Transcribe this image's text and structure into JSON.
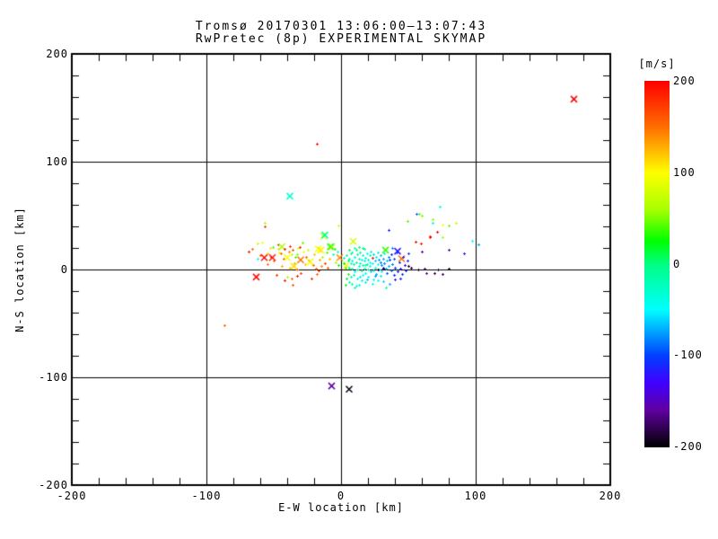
{
  "title": {
    "line1": "Tromsø 20170301 13:06:00–13:07:43",
    "line2": "RwPretec (8p) EXPERIMENTAL SKYMAP"
  },
  "axes": {
    "xlabel": "E-W location [km]",
    "ylabel": "N-S location [km]",
    "x_ticks": [
      "-200",
      "-100",
      "0",
      "100",
      "200"
    ],
    "x_tick_values": [
      -200,
      -100,
      0,
      100,
      200
    ],
    "y_ticks": [
      "200",
      "100",
      "0",
      "-100",
      "-200"
    ],
    "y_tick_values": [
      200,
      100,
      0,
      -100,
      -200
    ],
    "xlim": [
      -200,
      200
    ],
    "ylim": [
      -200,
      200
    ],
    "minor_tick_step_km": 20,
    "gridlines_km": [
      -100,
      0,
      100
    ]
  },
  "colorbar": {
    "unit_label": "[m/s]",
    "ticks": [
      "200",
      "100",
      "0",
      "-100",
      "-200"
    ],
    "tick_values": [
      200,
      100,
      0,
      -100,
      -200
    ],
    "vmin": -200,
    "vmax": 200,
    "anchors": [
      {
        "v": -200,
        "color": "#000000"
      },
      {
        "v": -180,
        "color": "#300050"
      },
      {
        "v": -160,
        "color": "#6000A0"
      },
      {
        "v": -130,
        "color": "#4000FF"
      },
      {
        "v": -100,
        "color": "#0040FF"
      },
      {
        "v": -75,
        "color": "#00A0FF"
      },
      {
        "v": -50,
        "color": "#00FFFF"
      },
      {
        "v": 0,
        "color": "#00FF82"
      },
      {
        "v": 25,
        "color": "#00FF00"
      },
      {
        "v": 60,
        "color": "#AAFF00"
      },
      {
        "v": 100,
        "color": "#FFFF00"
      },
      {
        "v": 150,
        "color": "#FF6E00"
      },
      {
        "v": 200,
        "color": "#FF0000"
      }
    ]
  },
  "chart_data": {
    "type": "scatter",
    "title": "Tromsø 20170301 13:06:00–13:07:43 / RwPretec (8p) EXPERIMENTAL SKYMAP",
    "xlabel": "E-W location [km]",
    "ylabel": "N-S location [km]",
    "xlim": [
      -200,
      200
    ],
    "ylim": [
      -200,
      200
    ],
    "color_variable": "line-of-sight velocity [m/s]",
    "point_format": [
      "x_km",
      "y_km",
      "velocity_ms",
      "marker(d=dot,x=cross)"
    ],
    "points": [
      [
        -69,
        17,
        190,
        "d"
      ],
      [
        -66,
        19,
        150,
        "d"
      ],
      [
        -63,
        -7,
        195,
        "x"
      ],
      [
        -62,
        10,
        -50,
        "d"
      ],
      [
        -62,
        24,
        80,
        "d"
      ],
      [
        -60,
        13,
        155,
        "d"
      ],
      [
        -59,
        25,
        100,
        "d"
      ],
      [
        -57,
        11,
        195,
        "x"
      ],
      [
        -57,
        40,
        170,
        "d"
      ],
      [
        -57,
        43,
        60,
        "d"
      ],
      [
        -55,
        15,
        120,
        "d"
      ],
      [
        -55,
        5,
        145,
        "d"
      ],
      [
        -53,
        20,
        110,
        "d"
      ],
      [
        -52,
        12,
        185,
        "d"
      ],
      [
        -51,
        11,
        190,
        "x"
      ],
      [
        -51,
        21,
        40,
        "d"
      ],
      [
        -50,
        8,
        160,
        "d"
      ],
      [
        -48,
        -5,
        175,
        "d"
      ],
      [
        -47,
        23,
        185,
        "d"
      ],
      [
        -47,
        19,
        65,
        "d"
      ],
      [
        -46,
        16,
        90,
        "d"
      ],
      [
        -45,
        15,
        150,
        "d"
      ],
      [
        -44,
        21,
        60,
        "x"
      ],
      [
        -44,
        3,
        130,
        "d"
      ],
      [
        -43,
        10,
        170,
        "d"
      ],
      [
        -42,
        19,
        185,
        "d"
      ],
      [
        -42,
        -10,
        190,
        "d"
      ],
      [
        -40,
        11,
        100,
        "x"
      ],
      [
        -40,
        -7,
        60,
        "d"
      ],
      [
        -39,
        17,
        140,
        "d"
      ],
      [
        -38,
        22,
        180,
        "d"
      ],
      [
        -38,
        2,
        120,
        "d"
      ],
      [
        -37,
        14,
        70,
        "d"
      ],
      [
        -37,
        -8,
        150,
        "d"
      ],
      [
        -36,
        18,
        160,
        "d"
      ],
      [
        -36,
        -14,
        160,
        "d"
      ],
      [
        -35,
        6,
        130,
        "d"
      ],
      [
        -35,
        3,
        110,
        "x"
      ],
      [
        -34,
        12,
        40,
        "d"
      ],
      [
        -33,
        14,
        50,
        "d"
      ],
      [
        -33,
        0,
        150,
        "d"
      ],
      [
        -33,
        -6,
        190,
        "d"
      ],
      [
        -32,
        20,
        90,
        "d"
      ],
      [
        -31,
        21,
        180,
        "d"
      ],
      [
        -30,
        9,
        150,
        "x"
      ],
      [
        -30,
        -3,
        170,
        "d"
      ],
      [
        -29,
        25,
        45,
        "d"
      ],
      [
        -28,
        17,
        100,
        "d"
      ],
      [
        -27,
        5,
        120,
        "d"
      ],
      [
        -26,
        12,
        150,
        "d"
      ],
      [
        -25,
        18,
        75,
        "d"
      ],
      [
        -24,
        8,
        185,
        "d"
      ],
      [
        -23,
        7,
        100,
        "x"
      ],
      [
        -22,
        -8,
        180,
        "d"
      ],
      [
        -21,
        4,
        150,
        "d"
      ],
      [
        -20,
        14,
        120,
        "d"
      ],
      [
        -19,
        1,
        165,
        "d"
      ],
      [
        -18,
        -4,
        150,
        "d"
      ],
      [
        -17,
        -1,
        190,
        "d"
      ],
      [
        -17,
        19,
        95,
        "x"
      ],
      [
        -16,
        9,
        130,
        "d"
      ],
      [
        -15,
        3,
        140,
        "d"
      ],
      [
        -15,
        18,
        105,
        "x"
      ],
      [
        -14,
        12,
        60,
        "d"
      ],
      [
        -13,
        31,
        80,
        "x"
      ],
      [
        -12,
        32,
        -10,
        "x"
      ],
      [
        -12,
        6,
        170,
        "d"
      ],
      [
        -11,
        16,
        45,
        "d"
      ],
      [
        -10,
        2,
        155,
        "d"
      ],
      [
        -9,
        10,
        120,
        "d"
      ],
      [
        -8,
        21,
        30,
        "x"
      ],
      [
        -7,
        21,
        50,
        "x"
      ],
      [
        -6,
        14,
        -20,
        "d"
      ],
      [
        -5,
        19,
        35,
        "d"
      ],
      [
        -4,
        7,
        60,
        "d"
      ],
      [
        -3,
        17,
        -45,
        "d"
      ],
      [
        -2,
        4,
        25,
        "d"
      ],
      [
        -2,
        41,
        80,
        "d"
      ],
      [
        -1,
        11,
        140,
        "x"
      ],
      [
        3,
        -14,
        20,
        "d"
      ],
      [
        4,
        4,
        90,
        "x"
      ],
      [
        2,
        11,
        -15,
        "d"
      ],
      [
        5,
        -4,
        30,
        "d"
      ],
      [
        6,
        2,
        -10,
        "d"
      ],
      [
        6,
        10,
        -25,
        "d"
      ],
      [
        7,
        -7,
        -30,
        "d"
      ],
      [
        7,
        15,
        -5,
        "d"
      ],
      [
        8,
        1,
        -20,
        "d"
      ],
      [
        8,
        8,
        -35,
        "d"
      ],
      [
        8,
        -13,
        -25,
        "d"
      ],
      [
        9,
        26,
        80,
        "x"
      ],
      [
        9,
        5,
        -15,
        "d"
      ],
      [
        10,
        12,
        -30,
        "d"
      ],
      [
        10,
        -2,
        -40,
        "d"
      ],
      [
        10,
        -17,
        -30,
        "d"
      ],
      [
        11,
        7,
        -10,
        "d"
      ],
      [
        11,
        18,
        5,
        "d"
      ],
      [
        12,
        0,
        -25,
        "d"
      ],
      [
        12,
        -8,
        -45,
        "d"
      ],
      [
        13,
        10,
        -20,
        "d"
      ],
      [
        13,
        3,
        -35,
        "d"
      ],
      [
        13,
        -14,
        -40,
        "d"
      ],
      [
        14,
        16,
        -10,
        "d"
      ],
      [
        14,
        6,
        -30,
        "d"
      ],
      [
        15,
        -1,
        -15,
        "d"
      ],
      [
        15,
        9,
        -45,
        "d"
      ],
      [
        15,
        -10,
        -35,
        "d"
      ],
      [
        16,
        13,
        -25,
        "d"
      ],
      [
        16,
        4,
        -5,
        "d"
      ],
      [
        16,
        -5,
        -50,
        "d"
      ],
      [
        17,
        19,
        0,
        "d"
      ],
      [
        17,
        8,
        -35,
        "d"
      ],
      [
        17,
        1,
        -20,
        "d"
      ],
      [
        18,
        -3,
        -45,
        "d"
      ],
      [
        18,
        11,
        -30,
        "d"
      ],
      [
        18,
        -12,
        -55,
        "d"
      ],
      [
        19,
        5,
        -15,
        "d"
      ],
      [
        19,
        15,
        -40,
        "d"
      ],
      [
        20,
        0,
        -30,
        "d"
      ],
      [
        20,
        9,
        -55,
        "d"
      ],
      [
        20,
        -7,
        -45,
        "d"
      ],
      [
        21,
        13,
        -20,
        "d"
      ],
      [
        21,
        3,
        -40,
        "d"
      ],
      [
        22,
        -2,
        -60,
        "d"
      ],
      [
        22,
        17,
        -35,
        "d"
      ],
      [
        23,
        11,
        190,
        "d"
      ],
      [
        23,
        6,
        -50,
        "d"
      ],
      [
        24,
        -1,
        -40,
        "d"
      ],
      [
        24,
        14,
        -60,
        "d"
      ],
      [
        24,
        -9,
        -50,
        "d"
      ],
      [
        25,
        8,
        -65,
        "d"
      ],
      [
        25,
        2,
        -30,
        "d"
      ],
      [
        26,
        12,
        -55,
        "d"
      ],
      [
        26,
        -4,
        -70,
        "d"
      ],
      [
        27,
        5,
        -45,
        "d"
      ],
      [
        27,
        16,
        -25,
        "d"
      ],
      [
        28,
        0,
        -60,
        "d"
      ],
      [
        28,
        9,
        -75,
        "d"
      ],
      [
        29,
        -6,
        -55,
        "d"
      ],
      [
        29,
        13,
        -65,
        "d"
      ],
      [
        30,
        4,
        -80,
        "d"
      ],
      [
        30,
        -2,
        -50,
        "d"
      ],
      [
        31,
        10,
        -70,
        "d"
      ],
      [
        31,
        -11,
        -60,
        "d"
      ],
      [
        32,
        6,
        -85,
        "d"
      ],
      [
        32,
        15,
        -45,
        "d"
      ],
      [
        33,
        1,
        -75,
        "d"
      ],
      [
        33,
        18,
        35,
        "x"
      ],
      [
        34,
        -3,
        -90,
        "d"
      ],
      [
        34,
        8,
        -65,
        "d"
      ],
      [
        35,
        12,
        -80,
        "d"
      ],
      [
        35,
        3,
        -70,
        "d"
      ],
      [
        5,
        8,
        -5,
        "d"
      ],
      [
        4,
        -8,
        15,
        "d"
      ],
      [
        3,
        2,
        40,
        "d"
      ],
      [
        6,
        -12,
        -20,
        "d"
      ],
      [
        7,
        6,
        -40,
        "d"
      ],
      [
        9,
        -5,
        -30,
        "d"
      ],
      [
        11,
        -15,
        -35,
        "d"
      ],
      [
        12,
        14,
        -15,
        "d"
      ],
      [
        14,
        -7,
        -55,
        "d"
      ],
      [
        16,
        20,
        -10,
        "d"
      ],
      [
        18,
        4,
        -25,
        "d"
      ],
      [
        19,
        -9,
        -65,
        "d"
      ],
      [
        21,
        7,
        -45,
        "d"
      ],
      [
        23,
        -13,
        -40,
        "d"
      ],
      [
        25,
        -6,
        -75,
        "d"
      ],
      [
        27,
        -10,
        -50,
        "d"
      ],
      [
        29,
        7,
        -85,
        "d"
      ],
      [
        31,
        2,
        -95,
        "d"
      ],
      [
        2,
        6,
        20,
        "d"
      ],
      [
        4,
        13,
        -5,
        "d"
      ],
      [
        6,
        18,
        10,
        "d"
      ],
      [
        8,
        16,
        -20,
        "d"
      ],
      [
        10,
        20,
        -15,
        "d"
      ],
      [
        13,
        21,
        -5,
        "d"
      ],
      [
        27,
        0,
        -190,
        "d"
      ],
      [
        31,
        1,
        -180,
        "d"
      ],
      [
        36,
        9,
        -100,
        "d"
      ],
      [
        37,
        -1,
        -90,
        "d"
      ],
      [
        37,
        14,
        -110,
        "d"
      ],
      [
        38,
        5,
        -85,
        "d"
      ],
      [
        38,
        20,
        -80,
        "d"
      ],
      [
        39,
        -5,
        -105,
        "d"
      ],
      [
        39,
        10,
        -95,
        "d"
      ],
      [
        40,
        -9,
        -115,
        "d"
      ],
      [
        40,
        2,
        -100,
        "d"
      ],
      [
        41,
        16,
        -90,
        "d"
      ],
      [
        42,
        17,
        -120,
        "x"
      ],
      [
        42,
        -2,
        -110,
        "d"
      ],
      [
        43,
        7,
        -95,
        "d"
      ],
      [
        44,
        1,
        -125,
        "d"
      ],
      [
        44,
        -8,
        -115,
        "d"
      ],
      [
        45,
        10,
        150,
        "x"
      ],
      [
        45,
        -4,
        -105,
        "d"
      ],
      [
        46,
        12,
        -115,
        "d"
      ],
      [
        47,
        4,
        -130,
        "d"
      ],
      [
        48,
        -1,
        -120,
        "d"
      ],
      [
        49,
        8,
        -110,
        "d"
      ],
      [
        50,
        15,
        -100,
        "d"
      ],
      [
        36,
        -13,
        -70,
        "d"
      ],
      [
        50,
        3,
        -190,
        "d"
      ],
      [
        52,
        2,
        -185,
        "d"
      ],
      [
        55,
        26,
        195,
        "d"
      ],
      [
        57,
        0,
        -195,
        "d"
      ],
      [
        59,
        24,
        190,
        "d"
      ],
      [
        60,
        17,
        -150,
        "d"
      ],
      [
        62,
        1,
        -170,
        "d"
      ],
      [
        63,
        -3,
        -160,
        "d"
      ],
      [
        66,
        31,
        195,
        "d"
      ],
      [
        69,
        -3,
        -180,
        "d"
      ],
      [
        71,
        35,
        200,
        "d"
      ],
      [
        72,
        0,
        -185,
        "d"
      ],
      [
        75,
        -4,
        -175,
        "d"
      ],
      [
        75,
        30,
        60,
        "d"
      ],
      [
        80,
        1,
        -190,
        "d"
      ],
      [
        80,
        18,
        -155,
        "d"
      ],
      [
        66,
        30,
        195,
        "d"
      ],
      [
        -38,
        68,
        -30,
        "x"
      ],
      [
        -18,
        117,
        195,
        "d"
      ],
      [
        35,
        37,
        -110,
        "d"
      ],
      [
        49,
        45,
        40,
        "d"
      ],
      [
        56,
        52,
        -90,
        "d"
      ],
      [
        58,
        52,
        45,
        "d"
      ],
      [
        60,
        50,
        50,
        "d"
      ],
      [
        68,
        47,
        55,
        "d"
      ],
      [
        68,
        43,
        -35,
        "d"
      ],
      [
        73,
        58,
        -45,
        "d"
      ],
      [
        75,
        42,
        100,
        "d"
      ],
      [
        80,
        41,
        45,
        "d"
      ],
      [
        85,
        43,
        70,
        "d"
      ],
      [
        91,
        15,
        -120,
        "d"
      ],
      [
        97,
        27,
        -45,
        "d"
      ],
      [
        102,
        23,
        -75,
        "d"
      ],
      [
        173,
        158,
        200,
        "x"
      ],
      [
        -87,
        -52,
        150,
        "d"
      ],
      [
        -7,
        -108,
        -160,
        "x"
      ],
      [
        6,
        -111,
        -195,
        "x"
      ],
      [
        33,
        -17,
        -25,
        "d"
      ]
    ]
  }
}
